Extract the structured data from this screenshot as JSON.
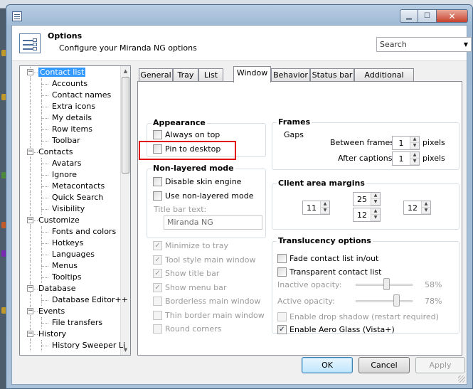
{
  "window": {
    "title": "Options",
    "subtitle": "Configure your Miranda NG options"
  },
  "search": {
    "placeholder": "Search"
  },
  "tree": {
    "items": [
      {
        "label": "Contact list",
        "level": 0,
        "selected": true
      },
      {
        "label": "Accounts",
        "level": 1
      },
      {
        "label": "Contact names",
        "level": 1
      },
      {
        "label": "Extra icons",
        "level": 1
      },
      {
        "label": "My details",
        "level": 1
      },
      {
        "label": "Row items",
        "level": 1
      },
      {
        "label": "Toolbar",
        "level": 1
      },
      {
        "label": "Contacts",
        "level": 0
      },
      {
        "label": "Avatars",
        "level": 1
      },
      {
        "label": "Ignore",
        "level": 1
      },
      {
        "label": "Metacontacts",
        "level": 1
      },
      {
        "label": "Quick Search",
        "level": 1
      },
      {
        "label": "Visibility",
        "level": 1
      },
      {
        "label": "Customize",
        "level": 0
      },
      {
        "label": "Fonts and colors",
        "level": 1
      },
      {
        "label": "Hotkeys",
        "level": 1
      },
      {
        "label": "Languages",
        "level": 1
      },
      {
        "label": "Menus",
        "level": 1
      },
      {
        "label": "Tooltips",
        "level": 1
      },
      {
        "label": "Database",
        "level": 0
      },
      {
        "label": "Database Editor++",
        "level": 1
      },
      {
        "label": "Events",
        "level": 0
      },
      {
        "label": "File transfers",
        "level": 1
      },
      {
        "label": "History",
        "level": 0
      },
      {
        "label": "History Sweeper Li",
        "level": 1
      }
    ]
  },
  "tabs": [
    "General",
    "Tray",
    "List",
    "Window",
    "Behavior",
    "Status bar",
    "Additional stuff"
  ],
  "active_tab": "Window",
  "appearance": {
    "title": "Appearance",
    "always_on_top": "Always on top",
    "pin_to_desktop": "Pin to desktop"
  },
  "non_layered": {
    "title": "Non-layered mode",
    "disable_skin": "Disable skin engine",
    "use_non_layered": "Use non-layered mode",
    "title_bar_text_label": "Title bar text:",
    "title_bar_text_value": "Miranda NG"
  },
  "window_opts": {
    "minimize_to_tray": "Minimize to tray",
    "tool_style": "Tool style main window",
    "show_title_bar": "Show title bar",
    "show_menu_bar": "Show menu bar",
    "borderless": "Borderless main window",
    "thin_border": "Thin border main window",
    "round_corners": "Round corners"
  },
  "frames": {
    "title": "Frames",
    "gaps": "Gaps",
    "between_frames": "Between frames:",
    "between_frames_value": "1",
    "after_captions": "After captions:",
    "after_captions_value": "1",
    "pixels": "pixels"
  },
  "margins": {
    "title": "Client area margins",
    "left": "11",
    "top": "25",
    "bottom": "12",
    "right": "12"
  },
  "translucency": {
    "title": "Translucency options",
    "fade": "Fade contact list in/out",
    "transparent": "Transparent contact list",
    "inactive_label": "Inactive opacity:",
    "inactive_value": "58%",
    "inactive_level": 58,
    "active_label": "Active opacity:",
    "active_value": "78%",
    "active_level": 78,
    "drop_shadow": "Enable drop shadow (restart required)",
    "aero_glass": "Enable Aero Glass (Vista+)"
  },
  "buttons": {
    "ok": "OK",
    "cancel": "Cancel",
    "apply": "Apply"
  },
  "colors": {
    "highlight": "#e01010",
    "selection": "#3399ff"
  }
}
